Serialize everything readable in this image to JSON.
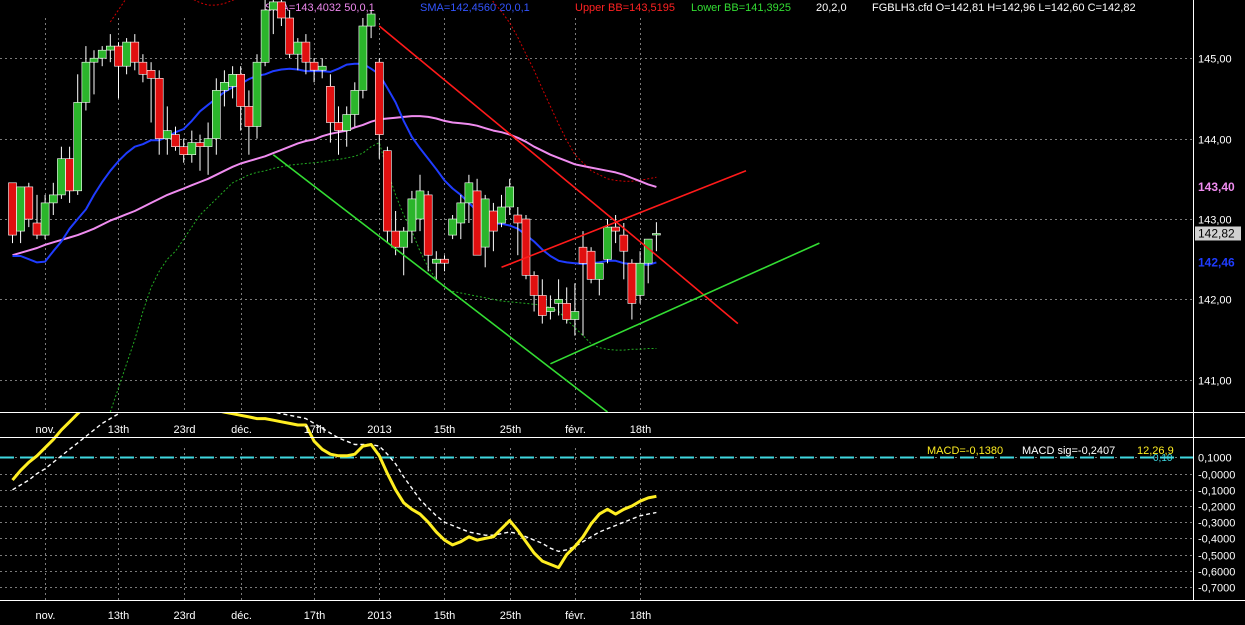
{
  "header": {
    "sma50_text": "SMA=143,4032  50,0,1",
    "sma20_text": "SMA=142,4560  20,0,1",
    "upper_bb_text": "Upper BB=143,5195",
    "lower_bb_text": "Lower BB=141,3925",
    "bb_params_text": "20,2,0",
    "ohlc_text": "FGBLH3.cfd O=142,81 H=142,96 L=142,60 C=142,82"
  },
  "macd_header": {
    "macd_text": "MACD=-0,1380",
    "sig_text": "MACD sig=-0,2407",
    "params_text": "12,26,9",
    "line_value_text": "0,10"
  },
  "colors": {
    "background": "#000000",
    "grid": "#7a7a7a",
    "up_candle": "#2bb52b",
    "down_candle": "#e01010",
    "sma20": "#1f3cff",
    "sma50": "#f08cf0",
    "bollinger": "#d00000",
    "bollinger_lower": "#22aa22",
    "trend_red": "#ff1a1a",
    "trend_green": "#33dd33",
    "macd": "#ffee22",
    "macd_signal": "#ffffff",
    "macd_zero": "#3fd8e0",
    "axis_text": "#ffffff"
  },
  "chart_data": [
    {
      "type": "candlestick",
      "symbol": "FGBLH3.cfd",
      "ylim": [
        140.6,
        145.5
      ],
      "yticks": [
        "145,00",
        "144,00",
        "143,00",
        "142,00",
        "141,00"
      ],
      "ytick_values": [
        145,
        144,
        143,
        142,
        141
      ],
      "right_labels": [
        {
          "text": "143,40",
          "value": 143.4,
          "color": "sma50"
        },
        {
          "text": "142,82",
          "value": 142.82,
          "color": "price"
        },
        {
          "text": "142,46",
          "value": 142.46,
          "color": "sma20"
        }
      ],
      "x_labels": [
        {
          "text": "nov.",
          "index": 4
        },
        {
          "text": "13th",
          "index": 13
        },
        {
          "text": "23rd",
          "index": 21
        },
        {
          "text": "déc.",
          "index": 28
        },
        {
          "text": "17th",
          "index": 37
        },
        {
          "text": "2013",
          "index": 45
        },
        {
          "text": "15th",
          "index": 53
        },
        {
          "text": "25th",
          "index": 61
        },
        {
          "text": "févr.",
          "index": 69
        },
        {
          "text": "18th",
          "index": 77
        }
      ],
      "candles": [
        [
          143.45,
          143.45,
          142.7,
          142.8
        ],
        [
          142.85,
          143.4,
          142.7,
          143.4
        ],
        [
          143.4,
          143.45,
          142.9,
          143.0
        ],
        [
          142.95,
          143.3,
          142.75,
          142.8
        ],
        [
          142.8,
          143.3,
          142.75,
          143.2
        ],
        [
          143.2,
          143.45,
          143.05,
          143.3
        ],
        [
          143.3,
          143.9,
          143.25,
          143.75
        ],
        [
          143.75,
          143.9,
          143.2,
          143.35
        ],
        [
          143.35,
          144.8,
          143.3,
          144.45
        ],
        [
          144.45,
          145.15,
          144.35,
          144.95
        ],
        [
          144.95,
          145.1,
          144.55,
          145.0
        ],
        [
          145.0,
          145.15,
          144.9,
          145.1
        ],
        [
          145.1,
          145.3,
          144.95,
          145.15
        ],
        [
          145.15,
          145.2,
          144.5,
          144.9
        ],
        [
          144.9,
          145.25,
          144.8,
          145.2
        ],
        [
          145.2,
          145.3,
          144.85,
          144.95
        ],
        [
          144.95,
          145.05,
          144.7,
          144.8
        ],
        [
          144.85,
          144.95,
          144.2,
          144.75
        ],
        [
          144.75,
          144.85,
          143.8,
          144.0
        ],
        [
          144.0,
          144.4,
          143.8,
          144.1
        ],
        [
          144.05,
          144.15,
          143.85,
          143.9
        ],
        [
          143.9,
          144.0,
          143.7,
          143.8
        ],
        [
          143.8,
          144.1,
          143.7,
          143.95
        ],
        [
          143.95,
          144.05,
          143.6,
          143.9
        ],
        [
          143.9,
          144.2,
          143.55,
          144.0
        ],
        [
          144.0,
          144.75,
          143.8,
          144.6
        ],
        [
          144.6,
          144.85,
          144.4,
          144.7
        ],
        [
          144.65,
          144.9,
          144.5,
          144.8
        ],
        [
          144.8,
          144.9,
          144.1,
          144.4
        ],
        [
          144.4,
          144.6,
          143.8,
          144.15
        ],
        [
          144.15,
          145.05,
          144.0,
          144.95
        ],
        [
          144.95,
          145.8,
          144.9,
          145.6
        ],
        [
          145.6,
          145.9,
          145.3,
          145.7
        ],
        [
          145.7,
          145.9,
          145.4,
          145.5
        ],
        [
          145.5,
          145.6,
          145.0,
          145.05
        ],
        [
          145.05,
          145.25,
          144.85,
          145.2
        ],
        [
          145.2,
          145.3,
          144.8,
          144.95
        ],
        [
          144.95,
          145.0,
          144.7,
          144.85
        ],
        [
          144.85,
          145.0,
          144.75,
          144.9
        ],
        [
          144.65,
          144.8,
          143.95,
          144.2
        ],
        [
          144.2,
          144.4,
          143.8,
          144.1
        ],
        [
          144.1,
          144.4,
          143.9,
          144.3
        ],
        [
          144.3,
          144.7,
          144.15,
          144.6
        ],
        [
          144.6,
          145.5,
          144.5,
          145.4
        ],
        [
          145.4,
          145.6,
          145.25,
          145.55
        ],
        [
          144.95,
          145.0,
          143.75,
          144.05
        ],
        [
          143.85,
          143.9,
          142.7,
          142.85
        ],
        [
          142.85,
          143.1,
          142.55,
          142.65
        ],
        [
          142.65,
          142.9,
          142.3,
          142.85
        ],
        [
          142.85,
          143.35,
          142.7,
          143.25
        ],
        [
          143.0,
          143.55,
          142.85,
          143.35
        ],
        [
          143.3,
          143.35,
          142.35,
          142.55
        ],
        [
          142.45,
          142.6,
          142.25,
          142.5
        ],
        [
          142.5,
          142.55,
          142.35,
          142.45
        ],
        [
          142.8,
          143.05,
          142.75,
          143.0
        ],
        [
          142.95,
          143.3,
          142.75,
          143.2
        ],
        [
          143.2,
          143.55,
          142.95,
          143.45
        ],
        [
          143.35,
          143.5,
          142.55,
          142.55
        ],
        [
          142.65,
          143.3,
          142.4,
          143.25
        ],
        [
          143.1,
          143.2,
          142.6,
          142.85
        ],
        [
          142.95,
          143.3,
          142.9,
          143.15
        ],
        [
          143.15,
          143.5,
          143.05,
          143.4
        ],
        [
          143.05,
          143.15,
          142.55,
          142.95
        ],
        [
          143.0,
          143.05,
          142.25,
          142.3
        ],
        [
          142.3,
          142.35,
          141.85,
          142.05
        ],
        [
          142.05,
          142.25,
          141.7,
          141.8
        ],
        [
          141.85,
          142.05,
          141.75,
          141.9
        ],
        [
          141.95,
          142.25,
          141.8,
          142.0
        ],
        [
          141.95,
          142.15,
          141.7,
          141.75
        ],
        [
          141.75,
          142.2,
          141.55,
          141.85
        ],
        [
          142.65,
          142.85,
          141.55,
          142.45
        ],
        [
          142.6,
          142.65,
          142.2,
          142.25
        ],
        [
          142.25,
          142.45,
          142.05,
          142.45
        ],
        [
          142.5,
          143.0,
          142.45,
          142.9
        ],
        [
          142.9,
          143.05,
          142.7,
          142.85
        ],
        [
          142.8,
          142.95,
          142.25,
          142.6
        ],
        [
          142.45,
          142.5,
          141.75,
          141.95
        ],
        [
          142.05,
          142.6,
          141.95,
          142.45
        ],
        [
          142.45,
          142.75,
          142.2,
          142.75
        ],
        [
          142.81,
          142.96,
          142.6,
          142.82
        ]
      ],
      "sma20": [
        142.54,
        142.54,
        142.5,
        142.46,
        142.47,
        142.6,
        142.72,
        142.88,
        143.0,
        143.12,
        143.3,
        143.46,
        143.6,
        143.72,
        143.82,
        143.9,
        143.93,
        143.98,
        143.98,
        144.02,
        144.08,
        144.12,
        144.22,
        144.34,
        144.42,
        144.5,
        144.58,
        144.64,
        144.68,
        144.74,
        144.78,
        144.8,
        144.84,
        144.86,
        144.87,
        144.86,
        144.84,
        144.84,
        144.84,
        144.83,
        144.87,
        144.92,
        144.93,
        144.93,
        144.87,
        144.8,
        144.63,
        144.45,
        144.22,
        144.02,
        143.88,
        143.75,
        143.62,
        143.48,
        143.38,
        143.3,
        143.2,
        143.1,
        143.02,
        142.94,
        142.94,
        142.92,
        142.88,
        142.8,
        142.72,
        142.62,
        142.54,
        142.48,
        142.46,
        142.45,
        142.44,
        142.45,
        142.46,
        142.48,
        142.48,
        142.45,
        142.44,
        142.44,
        142.43,
        142.46
      ],
      "sma50": [
        142.55,
        142.58,
        142.61,
        142.64,
        142.68,
        142.71,
        142.74,
        142.77,
        142.8,
        142.84,
        142.88,
        142.93,
        142.98,
        143.02,
        143.06,
        143.1,
        143.15,
        143.2,
        143.25,
        143.3,
        143.34,
        143.38,
        143.42,
        143.46,
        143.5,
        143.55,
        143.6,
        143.65,
        143.69,
        143.72,
        143.75,
        143.78,
        143.82,
        143.86,
        143.9,
        143.94,
        143.97,
        143.99,
        144.03,
        144.06,
        144.08,
        144.1,
        144.14,
        144.17,
        144.21,
        144.24,
        144.25,
        144.26,
        144.27,
        144.28,
        144.28,
        144.27,
        144.25,
        144.22,
        144.2,
        144.19,
        144.18,
        144.16,
        144.13,
        144.1,
        144.08,
        144.05,
        144.01,
        143.96,
        143.9,
        143.85,
        143.8,
        143.76,
        143.72,
        143.68,
        143.66,
        143.64,
        143.62,
        143.6,
        143.58,
        143.55,
        143.51,
        143.47,
        143.43,
        143.4
      ],
      "upper_bb": [
        null,
        null,
        null,
        null,
        null,
        null,
        null,
        null,
        null,
        null,
        null,
        null,
        145.45,
        145.6,
        145.75,
        145.88,
        145.98,
        146.02,
        146.0,
        145.95,
        145.88,
        145.8,
        145.74,
        145.69,
        145.66,
        145.66,
        145.68,
        145.72,
        145.76,
        145.8,
        145.86,
        145.92,
        145.98,
        146.06,
        146.12,
        146.16,
        146.2,
        146.25,
        146.3,
        146.33,
        146.36,
        146.38,
        146.4,
        146.42,
        146.43,
        146.44,
        146.45,
        146.44,
        146.42,
        146.4,
        146.35,
        146.3,
        146.24,
        146.18,
        146.12,
        146.06,
        145.98,
        145.9,
        145.8,
        145.7,
        145.58,
        145.44,
        145.26,
        145.05,
        144.85,
        144.62,
        144.4,
        144.18,
        143.98,
        143.8,
        143.7,
        143.6,
        143.55,
        143.5,
        143.48,
        143.47,
        143.47,
        143.48,
        143.5,
        143.52
      ],
      "lower_bb": [
        null,
        null,
        null,
        null,
        null,
        null,
        null,
        null,
        null,
        null,
        null,
        null,
        140.6,
        140.9,
        141.2,
        141.5,
        141.85,
        142.15,
        142.35,
        142.5,
        142.6,
        142.75,
        142.9,
        143.05,
        143.15,
        143.25,
        143.35,
        143.45,
        143.5,
        143.55,
        143.58,
        143.6,
        143.63,
        143.65,
        143.67,
        143.68,
        143.69,
        143.7,
        143.71,
        143.73,
        143.74,
        143.76,
        143.78,
        143.82,
        143.9,
        143.95,
        143.6,
        143.3,
        143.05,
        142.85,
        142.6,
        142.4,
        142.25,
        142.15,
        142.1,
        142.08,
        142.06,
        142.04,
        142.02,
        142.0,
        141.98,
        141.97,
        141.96,
        141.95,
        141.94,
        141.93,
        141.9,
        141.85,
        141.75,
        141.65,
        141.55,
        141.45,
        141.4,
        141.38,
        141.37,
        141.37,
        141.38,
        141.38,
        141.39,
        141.39
      ],
      "trendlines": [
        {
          "color": "trend_red",
          "points": [
            [
              45,
              145.4
            ],
            [
              79,
              142.55
            ],
            [
              89,
              141.7
            ]
          ]
        },
        {
          "color": "trend_red",
          "points": [
            [
              60,
              142.4
            ],
            [
              90,
              143.6
            ]
          ]
        },
        {
          "color": "trend_green",
          "points": [
            [
              32,
              143.8
            ],
            [
              73,
              140.6
            ]
          ]
        },
        {
          "color": "trend_green",
          "points": [
            [
              66,
              141.2
            ],
            [
              99,
              142.7
            ]
          ]
        }
      ]
    },
    {
      "type": "line",
      "name": "MACD",
      "ylim": [
        -0.78,
        0.22
      ],
      "yticks": [
        "0,1000",
        "-0,0000",
        "-0,1000",
        "-0,2000",
        "-0,3000",
        "-0,4000",
        "-0,5000",
        "-0,6000",
        "-0,7000"
      ],
      "ytick_values": [
        0.1,
        0.0,
        -0.1,
        -0.2,
        -0.3,
        -0.4,
        -0.5,
        -0.6,
        -0.7
      ],
      "zero_line": 0.1,
      "x_labels": [
        {
          "text": "nov.",
          "index": 4
        },
        {
          "text": "13th",
          "index": 13
        },
        {
          "text": "23rd",
          "index": 21
        },
        {
          "text": "déc.",
          "index": 28
        },
        {
          "text": "17th",
          "index": 37
        },
        {
          "text": "2013",
          "index": 45
        },
        {
          "text": "15th",
          "index": 53
        },
        {
          "text": "25th",
          "index": 61
        },
        {
          "text": "févr.",
          "index": 69
        },
        {
          "text": "18th",
          "index": 77
        }
      ],
      "macd": [
        -0.04,
        0.02,
        0.07,
        0.11,
        0.16,
        0.21,
        0.27,
        0.32,
        0.37,
        0.42,
        0.46,
        0.5,
        0.53,
        0.55,
        0.56,
        0.57,
        0.56,
        0.55,
        0.53,
        0.51,
        0.49,
        0.47,
        0.45,
        0.43,
        0.41,
        0.39,
        0.38,
        0.37,
        0.36,
        0.35,
        0.34,
        0.34,
        0.33,
        0.32,
        0.31,
        0.3,
        0.3,
        0.2,
        0.15,
        0.12,
        0.11,
        0.11,
        0.12,
        0.17,
        0.18,
        0.11,
        0.0,
        -0.1,
        -0.18,
        -0.22,
        -0.25,
        -0.3,
        -0.36,
        -0.41,
        -0.44,
        -0.42,
        -0.39,
        -0.41,
        -0.4,
        -0.39,
        -0.34,
        -0.29,
        -0.35,
        -0.42,
        -0.49,
        -0.54,
        -0.56,
        -0.58,
        -0.5,
        -0.45,
        -0.39,
        -0.31,
        -0.25,
        -0.22,
        -0.25,
        -0.22,
        -0.2,
        -0.17,
        -0.15,
        -0.14
      ],
      "signal": [
        -0.1,
        -0.07,
        -0.04,
        0.0,
        0.03,
        0.07,
        0.11,
        0.15,
        0.19,
        0.23,
        0.27,
        0.31,
        0.34,
        0.37,
        0.4,
        0.42,
        0.44,
        0.46,
        0.47,
        0.48,
        0.48,
        0.48,
        0.48,
        0.47,
        0.46,
        0.45,
        0.44,
        0.43,
        0.42,
        0.41,
        0.4,
        0.39,
        0.38,
        0.37,
        0.36,
        0.35,
        0.34,
        0.31,
        0.28,
        0.25,
        0.22,
        0.2,
        0.18,
        0.18,
        0.18,
        0.17,
        0.12,
        0.06,
        -0.02,
        -0.09,
        -0.16,
        -0.21,
        -0.26,
        -0.3,
        -0.32,
        -0.34,
        -0.36,
        -0.37,
        -0.38,
        -0.38,
        -0.37,
        -0.36,
        -0.37,
        -0.39,
        -0.41,
        -0.43,
        -0.46,
        -0.48,
        -0.47,
        -0.45,
        -0.42,
        -0.39,
        -0.36,
        -0.34,
        -0.32,
        -0.3,
        -0.28,
        -0.26,
        -0.25,
        -0.24
      ]
    }
  ]
}
